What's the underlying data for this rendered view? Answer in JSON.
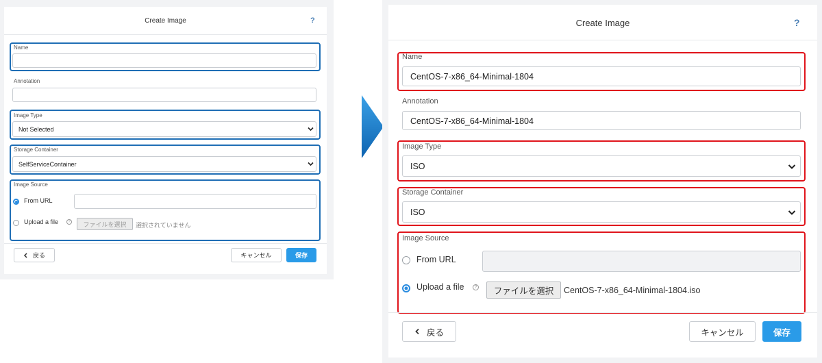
{
  "before": {
    "title": "Create Image",
    "help": "?",
    "name": {
      "label": "Name",
      "value": ""
    },
    "annotation": {
      "label": "Annotation",
      "value": ""
    },
    "image_type": {
      "label": "Image Type",
      "value": "Not Selected"
    },
    "storage_container": {
      "label": "Storage Container",
      "value": "SelfServiceContainer"
    },
    "image_source": {
      "label": "Image Source",
      "from_url_label": "From URL",
      "from_url_value": "",
      "upload_label": "Upload a file",
      "choose_file_label": "ファイルを選択",
      "file_status": "選択されていません",
      "selected": "from_url"
    },
    "footer": {
      "back": "戻る",
      "cancel": "キャンセル",
      "save": "保存"
    }
  },
  "after": {
    "title": "Create Image",
    "help": "?",
    "name": {
      "label": "Name",
      "value": "CentOS-7-x86_64-Minimal-1804"
    },
    "annotation": {
      "label": "Annotation",
      "value": "CentOS-7-x86_64-Minimal-1804"
    },
    "image_type": {
      "label": "Image Type",
      "value": "ISO"
    },
    "storage_container": {
      "label": "Storage Container",
      "value": "ISO"
    },
    "image_source": {
      "label": "Image Source",
      "from_url_label": "From URL",
      "from_url_value": "",
      "upload_label": "Upload a file",
      "choose_file_label": "ファイルを選択",
      "file_status": "CentOS-7-x86_64-Minimal-1804.iso",
      "selected": "upload"
    },
    "footer": {
      "back": "戻る",
      "cancel": "キャンセル",
      "save": "保存"
    }
  },
  "colors": {
    "highlight_before": "#1f6eb5",
    "highlight_after": "#e0141b",
    "arrow": "#1a7fd0",
    "primary_button": "#2a9be8",
    "radio_selected": "#2a8ce0"
  },
  "icons": [
    "help-icon",
    "chevron-down-icon",
    "chevron-left-icon",
    "info-icon",
    "right-arrow-icon"
  ]
}
